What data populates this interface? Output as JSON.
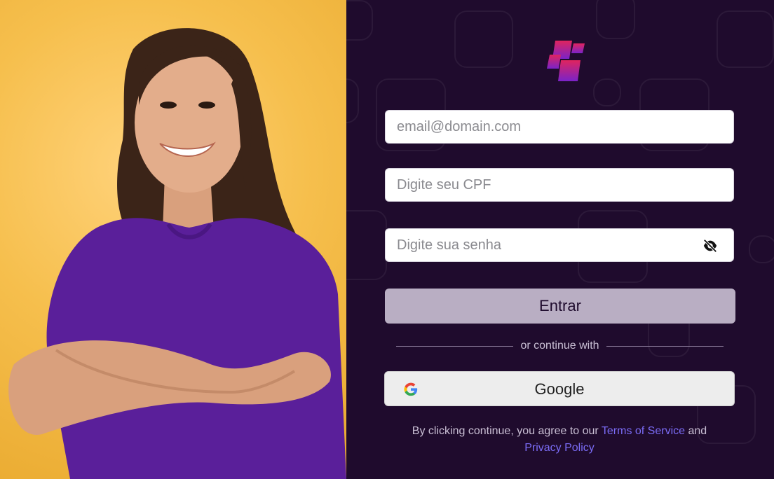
{
  "form": {
    "email_placeholder": "email@domain.com",
    "cpf_placeholder": "Digite seu CPF",
    "password_placeholder": "Digite sua senha",
    "submit_label": "Entrar"
  },
  "divider": {
    "text": "or continue with"
  },
  "social": {
    "google_label": "Google"
  },
  "terms": {
    "prefix": "By clicking continue, you agree to our",
    "terms_link": "Terms of Service",
    "joiner": "and",
    "privacy_link": "Privacy Policy"
  },
  "icons": {
    "logo": "brand-logo-icon",
    "password_toggle": "eye-off-icon",
    "google": "google-g-icon"
  },
  "colors": {
    "panel_bg": "#1f0b2d",
    "primary_button": "#b9aec3",
    "link": "#7b6cf6",
    "hero_bg": "#f6bf4d",
    "shirt": "#5a1f9a"
  }
}
